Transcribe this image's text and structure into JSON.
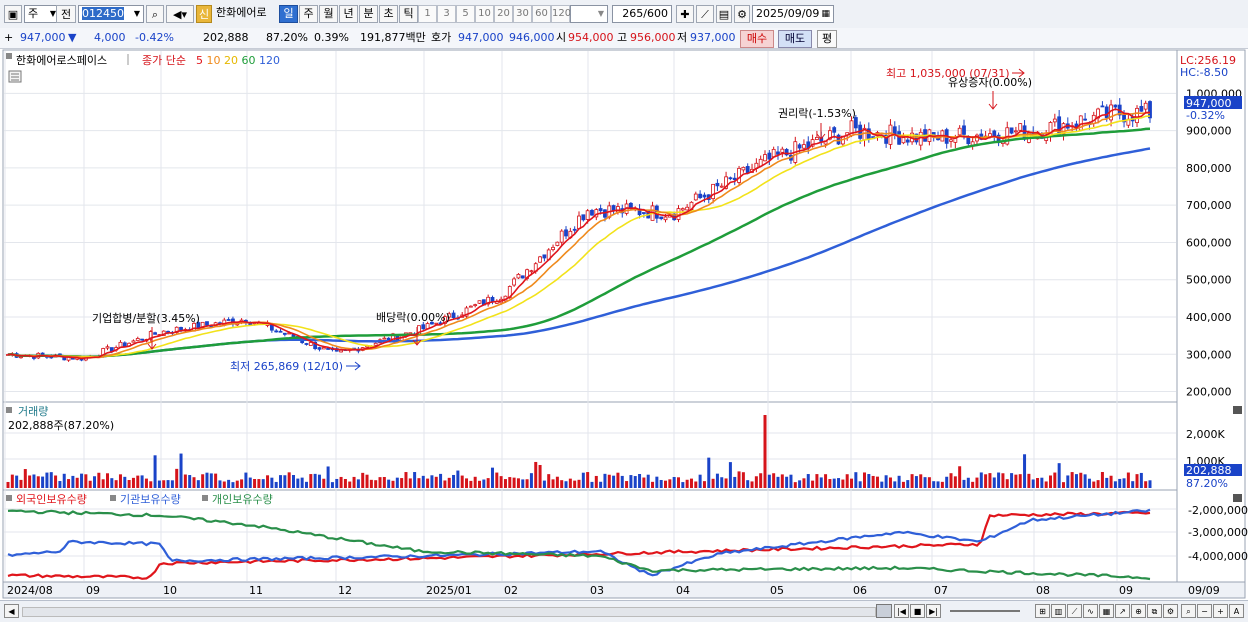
{
  "toolbar": {
    "period_main": "주",
    "prev_label": "전",
    "code": "012450",
    "badge": "신",
    "stock_name": "한화에어로",
    "timeframes": [
      {
        "label": "일",
        "active": true
      },
      {
        "label": "주",
        "active": false
      },
      {
        "label": "월",
        "active": false
      },
      {
        "label": "년",
        "active": false
      },
      {
        "label": "분",
        "active": false
      },
      {
        "label": "초",
        "active": false
      },
      {
        "label": "틱",
        "active": false
      }
    ],
    "periods": [
      "1",
      "3",
      "5",
      "10",
      "20",
      "30",
      "60",
      "120"
    ],
    "count": "265",
    "count_total": "/600",
    "date": "2025/09/09"
  },
  "quote": {
    "price": "947,000",
    "direction": "▼",
    "change": "4,000",
    "change_pct": "-0.42%",
    "volume": "202,888",
    "volume_ratio": "87.20%",
    "turnover_pct": "0.39%",
    "amount": "191,877백만",
    "ask_label": "호가",
    "ask1": "947,000",
    "ask2": "946,000",
    "open_label": "시",
    "open": "954,000",
    "high_label": "고",
    "high": "956,000",
    "low_label": "저",
    "low": "937,000",
    "buy": "매수",
    "sell": "매도",
    "eval": "평"
  },
  "legend": {
    "name": "한화에어로스페이스",
    "type": "종가 단순",
    "ma": [
      {
        "label": "5",
        "color": "#e0151b"
      },
      {
        "label": "10",
        "color": "#ef8a1c"
      },
      {
        "label": "20",
        "color": "#f2e21a"
      },
      {
        "label": "60",
        "color": "#1f9d3a"
      },
      {
        "label": "120",
        "color": "#2f5fd8"
      }
    ]
  },
  "annotations": {
    "hi": "최고 1,035,000 (07/31)",
    "lo": "최저 265,869 (12/10)",
    "merge": "기업합병/분할(3.45%)",
    "div": "배당락(0.00%)",
    "rights": "권리락(-1.53%)",
    "paid": "유상증자(0.00%)"
  },
  "price_axis": {
    "lc": "LC:256.19",
    "hc": "HC:-8.50",
    "ticks": [
      "1,000,000",
      "900,000",
      "800,000",
      "700,000",
      "600,000",
      "500,000",
      "400,000",
      "300,000",
      "200,000"
    ],
    "current": "947,000",
    "current_pct": "-0.32%"
  },
  "volume_panel": {
    "title": "거래량",
    "value": "202,888주(87.20%)",
    "ticks": [
      "2,000K",
      "1,000K"
    ],
    "current": "202,888",
    "current_pct": "87.20%"
  },
  "holding_panel": {
    "series": [
      {
        "name": "외국인보유수량",
        "color": "#e0151b"
      },
      {
        "name": "기관보유수량",
        "color": "#2f5fd8"
      },
      {
        "name": "개인보유수량",
        "color": "#2a8f4a"
      }
    ],
    "ticks": [
      "-2,000,000",
      "-3,000,000",
      "-4,000,000"
    ]
  },
  "x_axis": {
    "labels": [
      "2024/08",
      "09",
      "10",
      "11",
      "12",
      "2025/01",
      "02",
      "03",
      "04",
      "05",
      "06",
      "07",
      "08",
      "09"
    ],
    "last": "09/09"
  },
  "chart_data": {
    "type": "candlestick",
    "title": "한화에어로스페이스",
    "price_ylim": [
      180000,
      1060000
    ],
    "months": [
      "2024/08",
      "09",
      "10",
      "11",
      "12",
      "2025/01",
      "02",
      "03",
      "04",
      "05",
      "06",
      "07",
      "08",
      "09"
    ],
    "close_trend": [
      {
        "x": "2024/08",
        "y": 300000
      },
      {
        "x": "09",
        "y": 290000
      },
      {
        "x": "10",
        "y": 360000
      },
      {
        "x": "11",
        "y": 395000
      },
      {
        "x": "12",
        "y": 300000
      },
      {
        "x": "2025/01",
        "y": 370000
      },
      {
        "x": "02",
        "y": 460000
      },
      {
        "x": "03",
        "y": 690000
      },
      {
        "x": "04",
        "y": 680000
      },
      {
        "x": "05",
        "y": 820000
      },
      {
        "x": "06",
        "y": 900000
      },
      {
        "x": "07",
        "y": 880000
      },
      {
        "x": "08",
        "y": 900000
      },
      {
        "x": "09",
        "y": 947000
      }
    ],
    "high": {
      "label": "최고",
      "value": 1035000,
      "date": "07/31"
    },
    "low": {
      "label": "최저",
      "value": 265869,
      "date": "12/10"
    },
    "volume_ylim": [
      0,
      2700000
    ],
    "holding_ylim": [
      -4800000,
      -1500000
    ]
  }
}
